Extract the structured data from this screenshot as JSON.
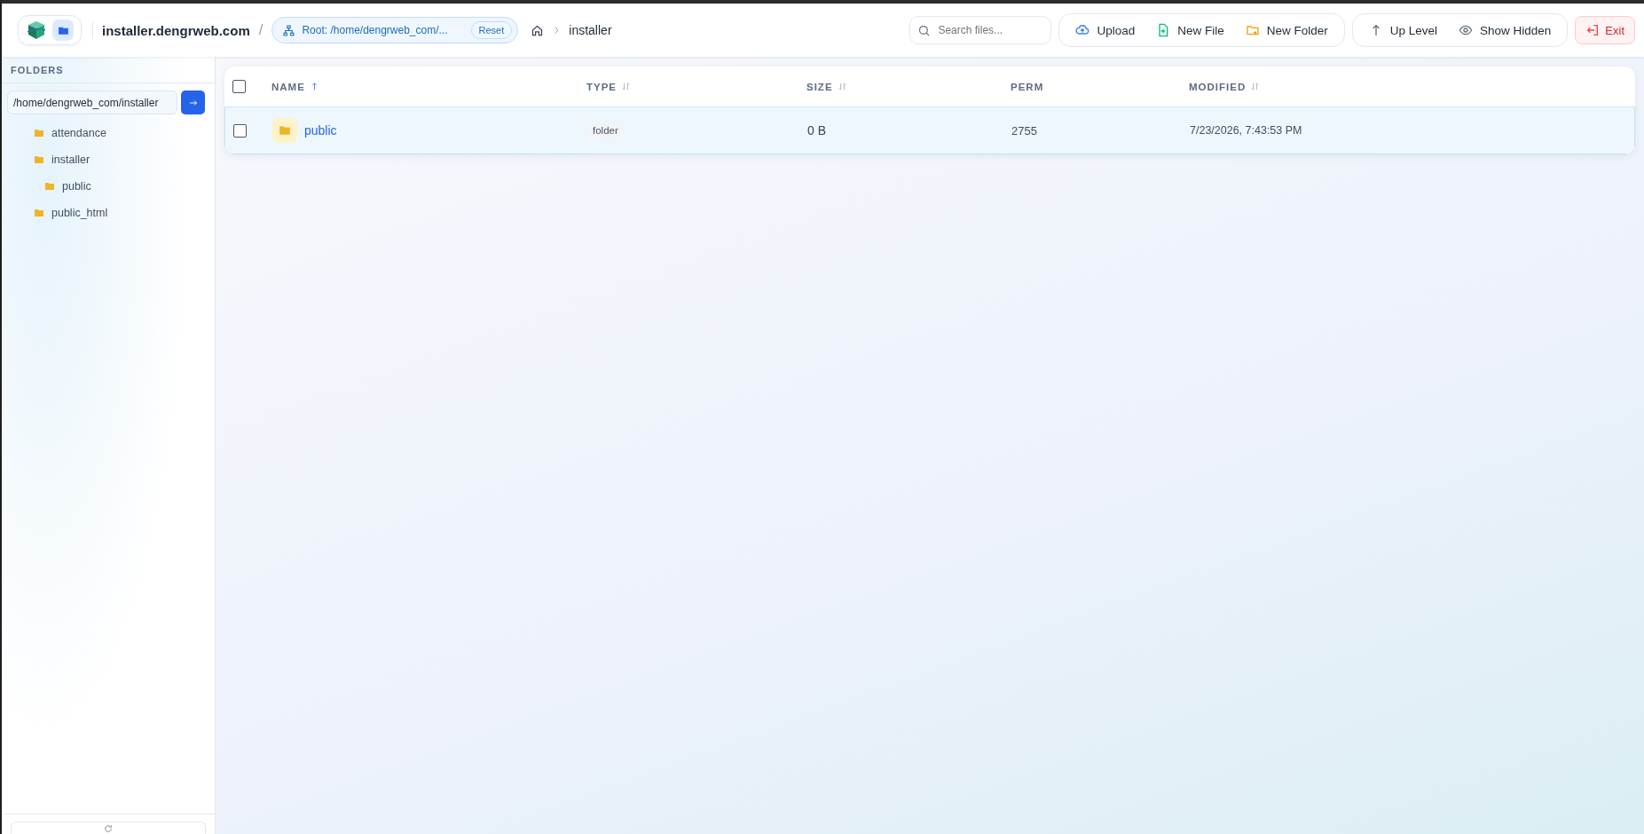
{
  "header": {
    "site": "installer.dengrweb.com",
    "separator": "/",
    "root": "Root: /home/dengrweb_com/...",
    "reset": "Reset",
    "breadcrumb": [
      {
        "label": "installer"
      }
    ],
    "search": {
      "placeholder": "Search files..."
    },
    "actions": [
      {
        "kind": "upload",
        "label": "Upload"
      },
      {
        "kind": "new-file",
        "label": "New File"
      },
      {
        "kind": "new-folder",
        "label": "New Folder"
      }
    ],
    "nav": [
      {
        "kind": "up",
        "label": "Up Level"
      },
      {
        "kind": "eye",
        "label": "Show Hidden"
      }
    ],
    "exit": "Exit"
  },
  "sidebar": {
    "title": "FOLDERS",
    "path": "/home/dengrweb_com/installer",
    "tree": [
      {
        "label": "attendance"
      },
      {
        "label": "installer",
        "children": [
          {
            "label": "public"
          }
        ]
      },
      {
        "label": "public_html"
      }
    ]
  },
  "table": {
    "all_checked": false,
    "columns": [
      {
        "label": "NAME",
        "sorted": true,
        "sortable": true
      },
      {
        "label": "TYPE",
        "sorted": false,
        "sortable": true
      },
      {
        "label": "SIZE",
        "sorted": false,
        "sortable": true
      },
      {
        "label": "PERM",
        "sorted": false,
        "sortable": false
      },
      {
        "label": "MODIFIED",
        "sorted": false,
        "sortable": true
      }
    ],
    "rows": [
      {
        "name": "public",
        "type": "folder",
        "size": "0 B",
        "perm": "2755",
        "modified": "7/23/2026, 7:43:53 PM",
        "selected": true,
        "checked": false
      }
    ]
  }
}
